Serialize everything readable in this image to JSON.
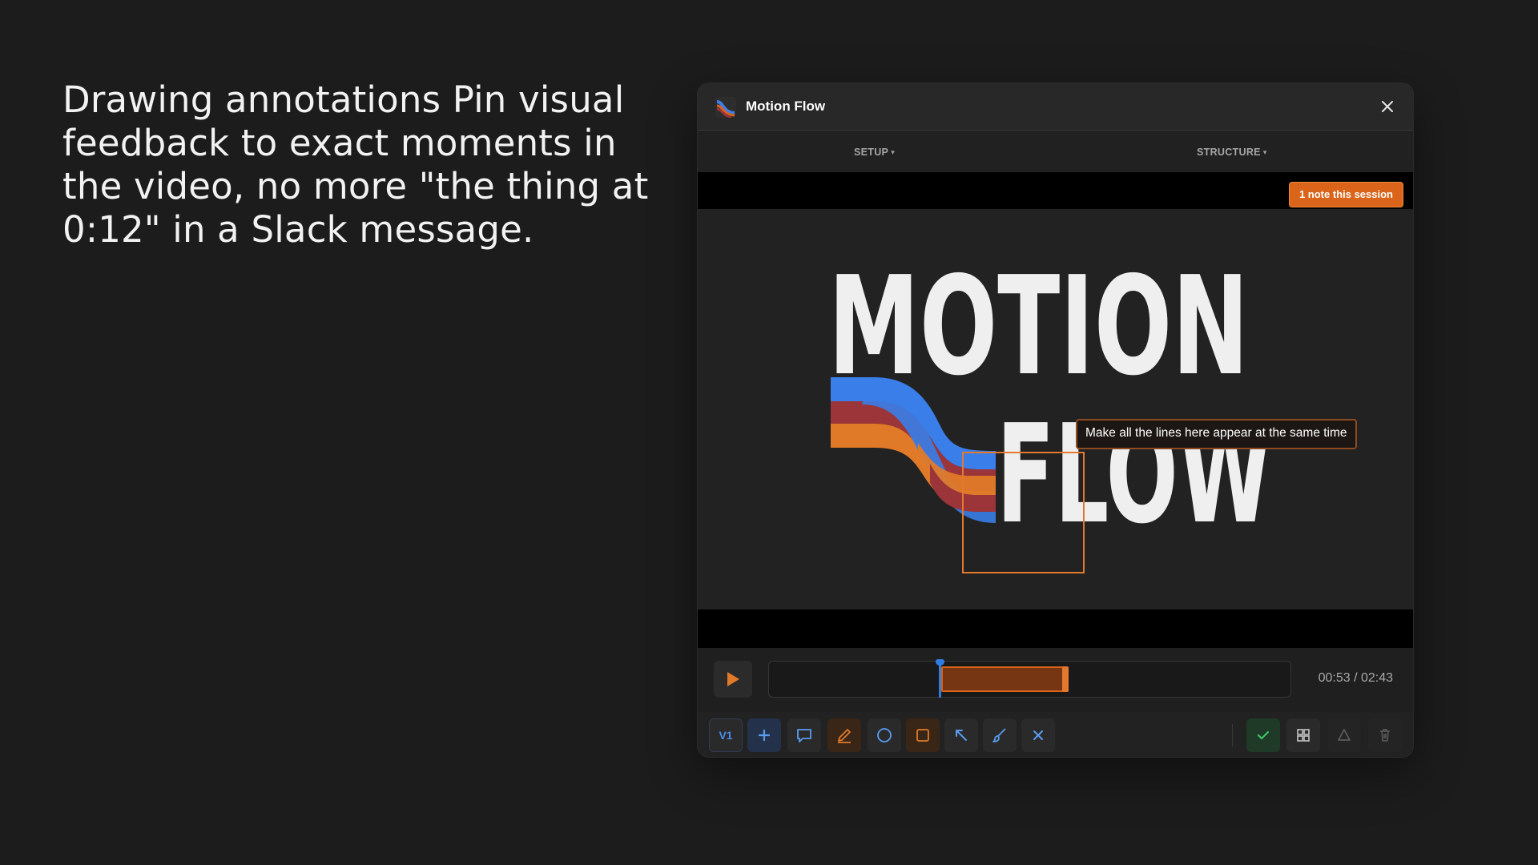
{
  "headline": "Drawing annotations Pin visual feedback to exact moments in the video, no more \"the thing at 0:12\" in a Slack message.",
  "window": {
    "title": "Motion Flow",
    "logo_icon": "motion-flow-logo-icon",
    "close_icon": "close-icon"
  },
  "menu": [
    {
      "label": "SETUP"
    },
    {
      "label": "STRUCTURE"
    }
  ],
  "video": {
    "session_badge": "1 note this session",
    "artwork_line1": "MOTION",
    "artwork_line2": "FLOW",
    "annotation_comment": "Make all the lines here appear at the same time",
    "annotation_color": "#e2792e"
  },
  "playback": {
    "current_time": "00:53",
    "duration": "02:43",
    "time_display": "00:53 / 02:43",
    "playhead_fraction": 0.325,
    "range_start_fraction": 0.33,
    "range_end_fraction": 0.575
  },
  "toolbar": {
    "version_label": "V1",
    "tools": [
      "add-icon",
      "comment-icon",
      "pencil-icon",
      "circle-icon",
      "square-icon",
      "arrow-icon",
      "brush-icon",
      "clear-icon"
    ],
    "right_tools": [
      "check-icon",
      "grid-icon",
      "eraser-icon",
      "trash-icon"
    ]
  },
  "colors": {
    "accent_orange": "#d9641a",
    "accent_blue": "#2f7de1",
    "background": "#1c1c1c"
  }
}
